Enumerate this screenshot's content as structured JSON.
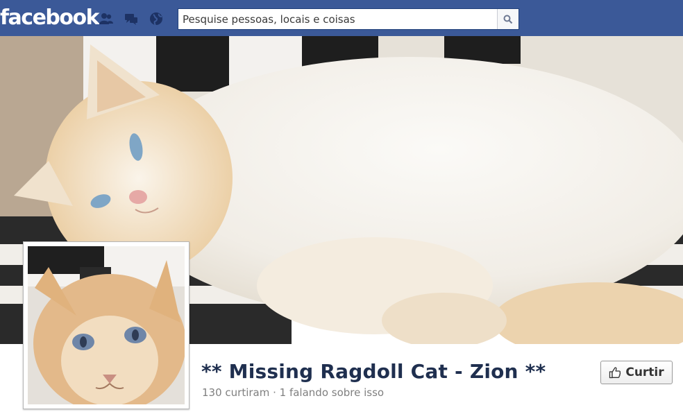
{
  "header": {
    "logo_text": "facebook",
    "search_placeholder": "Pesquise pessoas, locais e coisas",
    "icons": [
      "friend-requests-icon",
      "messages-icon",
      "notifications-globe-icon",
      "search-icon"
    ],
    "bar_color": "#3b5998"
  },
  "page": {
    "name": "** Missing Ragdoll Cat - Zion **",
    "stats": "130 curtiram · 1 falando sobre isso",
    "like_button_label": "Curtir",
    "like_icon": "thumbs-up-icon"
  }
}
